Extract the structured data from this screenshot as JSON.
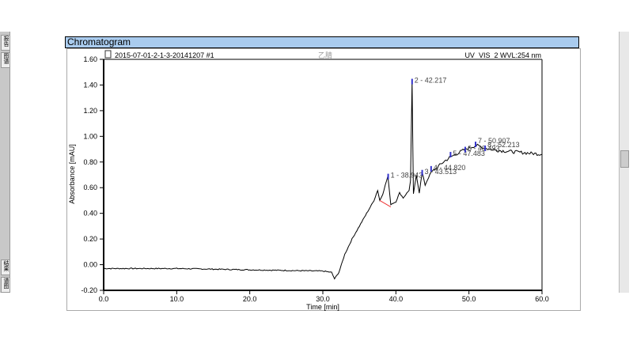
{
  "panel_title": "Chromatogram",
  "side_tabs": [
    "报告",
    "图谱",
    "结果",
    "谱图"
  ],
  "chart_data": {
    "type": "line",
    "header_left": "2015-07-01-2-1-3-20141207 #1",
    "header_center": "乙腈",
    "header_right": "UV_VIS_2 WVL:254 nm",
    "xlabel": "Time [min]",
    "ylabel": "Absorbance [mAU]",
    "xlim": [
      0,
      60
    ],
    "ylim": [
      -0.2,
      1.6
    ],
    "xticks": [
      "0.0",
      "10.0",
      "20.0",
      "30.0",
      "40.0",
      "50.0",
      "60.0"
    ],
    "yticks": [
      "-0.20",
      "0.00",
      "0.20",
      "0.40",
      "0.60",
      "0.80",
      "1.00",
      "1.20",
      "1.40",
      "1.60"
    ],
    "trace": {
      "x": [
        0,
        10,
        20,
        30,
        31.2,
        31.6,
        32.2,
        33,
        34,
        35,
        36,
        37,
        37.5,
        37.8,
        38.2,
        38.9,
        39.3,
        40,
        40.5,
        41,
        41.8,
        42.0,
        42.217,
        42.4,
        42.8,
        43.2,
        43.6,
        44,
        44.8,
        45.5,
        46.5,
        47.5,
        48.5,
        49.5,
        50.5,
        51,
        52,
        54,
        56,
        58,
        60
      ],
      "y": [
        -0.03,
        -0.03,
        -0.04,
        -0.05,
        -0.06,
        -0.11,
        -0.06,
        0.08,
        0.2,
        0.3,
        0.4,
        0.5,
        0.58,
        0.5,
        0.55,
        0.69,
        0.47,
        0.49,
        0.56,
        0.52,
        0.58,
        0.65,
        1.43,
        0.55,
        0.7,
        0.56,
        0.72,
        0.62,
        0.72,
        0.75,
        0.8,
        0.84,
        0.87,
        0.9,
        0.92,
        0.93,
        0.91,
        0.89,
        0.88,
        0.87,
        0.86
      ]
    },
    "peaks": [
      {
        "label": "1 - 38.943",
        "x": 38.943,
        "y": 0.69
      },
      {
        "label": "2 - 42.217",
        "x": 42.217,
        "y": 1.43
      },
      {
        "label": "3 - 43.513",
        "x": 43.6,
        "y": 0.72
      },
      {
        "label": "4 - 44.820",
        "x": 44.82,
        "y": 0.75
      },
      {
        "label": "5 - 47.483",
        "x": 47.48,
        "y": 0.86
      },
      {
        "label": "6 - 49.493",
        "x": 49.49,
        "y": 0.9
      },
      {
        "label": "7 - 50.907",
        "x": 50.907,
        "y": 0.94
      },
      {
        "label": "8 - 52.213",
        "x": 52.213,
        "y": 0.91
      }
    ]
  }
}
